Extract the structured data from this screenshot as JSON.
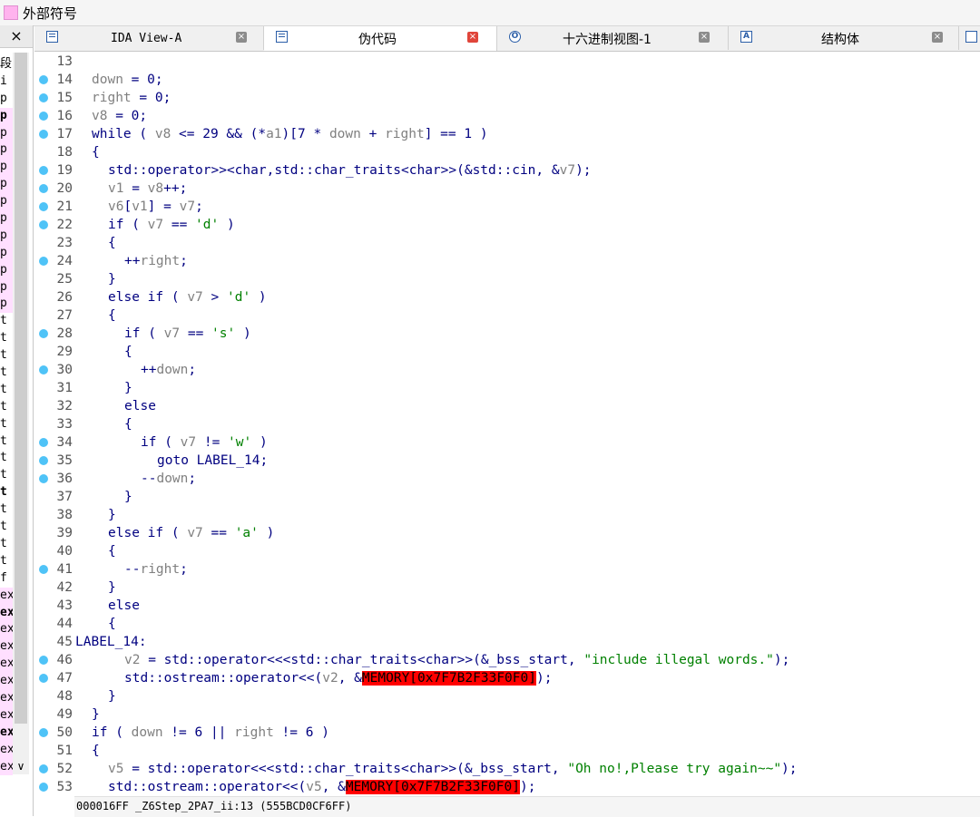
{
  "window": {
    "title": "外部符号"
  },
  "left_panel": {
    "close_label": "×",
    "items": [
      {
        "text": "段",
        "style": ""
      },
      {
        "text": "i",
        "style": ""
      },
      {
        "text": "p",
        "style": ""
      },
      {
        "text": "p",
        "style": "p b"
      },
      {
        "text": "p",
        "style": "p"
      },
      {
        "text": "p",
        "style": "p"
      },
      {
        "text": "p",
        "style": "p"
      },
      {
        "text": "p",
        "style": "p"
      },
      {
        "text": "p",
        "style": "p"
      },
      {
        "text": "p",
        "style": "p"
      },
      {
        "text": "p",
        "style": "p"
      },
      {
        "text": "p",
        "style": "p"
      },
      {
        "text": "p",
        "style": "p"
      },
      {
        "text": "p",
        "style": "p"
      },
      {
        "text": "p",
        "style": "p"
      },
      {
        "text": "t",
        "style": ""
      },
      {
        "text": "t",
        "style": ""
      },
      {
        "text": "t",
        "style": ""
      },
      {
        "text": "t",
        "style": ""
      },
      {
        "text": "t",
        "style": ""
      },
      {
        "text": "t",
        "style": ""
      },
      {
        "text": "t",
        "style": ""
      },
      {
        "text": "t",
        "style": ""
      },
      {
        "text": "t",
        "style": ""
      },
      {
        "text": "t",
        "style": ""
      },
      {
        "text": "t",
        "style": "b"
      },
      {
        "text": "t",
        "style": ""
      },
      {
        "text": "t",
        "style": ""
      },
      {
        "text": "t",
        "style": ""
      },
      {
        "text": "t",
        "style": ""
      },
      {
        "text": "f",
        "style": ""
      },
      {
        "text": "ex",
        "style": "p"
      },
      {
        "text": "ex",
        "style": "p b"
      },
      {
        "text": "ex",
        "style": "p"
      },
      {
        "text": "ex",
        "style": "p"
      },
      {
        "text": "ex",
        "style": "p"
      },
      {
        "text": "ex",
        "style": "p"
      },
      {
        "text": "ex",
        "style": "p"
      },
      {
        "text": "ex",
        "style": "p"
      },
      {
        "text": "ex",
        "style": "p b"
      },
      {
        "text": "ex",
        "style": "p"
      },
      {
        "text": "ex",
        "style": "p"
      }
    ]
  },
  "tabs": [
    {
      "label": "IDA View-A",
      "active": false,
      "icon": "ida-view-icon"
    },
    {
      "label": "伪代码",
      "active": true,
      "icon": "pseudocode-icon"
    },
    {
      "label": "十六进制视图-1",
      "active": false,
      "icon": "hex-view-icon"
    },
    {
      "label": "结构体",
      "active": false,
      "icon": "structures-icon"
    }
  ],
  "code": {
    "lines": [
      {
        "n": "13",
        "dot": false,
        "indent": 0,
        "parts": []
      },
      {
        "n": "14",
        "dot": true,
        "indent": 1,
        "parts": [
          [
            "v",
            "down"
          ],
          [
            "t",
            " = 0;"
          ]
        ]
      },
      {
        "n": "15",
        "dot": true,
        "indent": 1,
        "parts": [
          [
            "v",
            "right"
          ],
          [
            "t",
            " = 0;"
          ]
        ]
      },
      {
        "n": "16",
        "dot": true,
        "indent": 1,
        "parts": [
          [
            "v",
            "v8"
          ],
          [
            "t",
            " = 0;"
          ]
        ]
      },
      {
        "n": "17",
        "dot": true,
        "indent": 1,
        "parts": [
          [
            "t",
            "while ( "
          ],
          [
            "v",
            "v8"
          ],
          [
            "t",
            " <= 29 && (*"
          ],
          [
            "v",
            "a1"
          ],
          [
            "t",
            ")[7 * "
          ],
          [
            "v",
            "down"
          ],
          [
            "t",
            " + "
          ],
          [
            "v",
            "right"
          ],
          [
            "t",
            "] == 1 )"
          ]
        ]
      },
      {
        "n": "18",
        "dot": false,
        "indent": 1,
        "parts": [
          [
            "t",
            "{"
          ]
        ]
      },
      {
        "n": "19",
        "dot": true,
        "indent": 2,
        "parts": [
          [
            "t",
            "std::operator>><char,std::char_traits<char>>(&std::cin, &"
          ],
          [
            "v",
            "v7"
          ],
          [
            "t",
            ");"
          ]
        ]
      },
      {
        "n": "20",
        "dot": true,
        "indent": 2,
        "parts": [
          [
            "v",
            "v1"
          ],
          [
            "t",
            " = "
          ],
          [
            "v",
            "v8"
          ],
          [
            "t",
            "++;"
          ]
        ]
      },
      {
        "n": "21",
        "dot": true,
        "indent": 2,
        "parts": [
          [
            "v",
            "v6"
          ],
          [
            "t",
            "["
          ],
          [
            "v",
            "v1"
          ],
          [
            "t",
            "] = "
          ],
          [
            "v",
            "v7"
          ],
          [
            "t",
            ";"
          ]
        ]
      },
      {
        "n": "22",
        "dot": true,
        "indent": 2,
        "parts": [
          [
            "t",
            "if ( "
          ],
          [
            "v",
            "v7"
          ],
          [
            "t",
            " == "
          ],
          [
            "s",
            "'d'"
          ],
          [
            "t",
            " )"
          ]
        ]
      },
      {
        "n": "23",
        "dot": false,
        "indent": 2,
        "parts": [
          [
            "t",
            "{"
          ]
        ]
      },
      {
        "n": "24",
        "dot": true,
        "indent": 3,
        "parts": [
          [
            "t",
            "++"
          ],
          [
            "v",
            "right"
          ],
          [
            "t",
            ";"
          ]
        ]
      },
      {
        "n": "25",
        "dot": false,
        "indent": 2,
        "parts": [
          [
            "t",
            "}"
          ]
        ]
      },
      {
        "n": "26",
        "dot": false,
        "indent": 2,
        "parts": [
          [
            "t",
            "else if ( "
          ],
          [
            "v",
            "v7"
          ],
          [
            "t",
            " > "
          ],
          [
            "s",
            "'d'"
          ],
          [
            "t",
            " )"
          ]
        ]
      },
      {
        "n": "27",
        "dot": false,
        "indent": 2,
        "parts": [
          [
            "t",
            "{"
          ]
        ]
      },
      {
        "n": "28",
        "dot": true,
        "indent": 3,
        "parts": [
          [
            "t",
            "if ( "
          ],
          [
            "v",
            "v7"
          ],
          [
            "t",
            " == "
          ],
          [
            "s",
            "'s'"
          ],
          [
            "t",
            " )"
          ]
        ]
      },
      {
        "n": "29",
        "dot": false,
        "indent": 3,
        "parts": [
          [
            "t",
            "{"
          ]
        ]
      },
      {
        "n": "30",
        "dot": true,
        "indent": 4,
        "parts": [
          [
            "t",
            "++"
          ],
          [
            "v",
            "down"
          ],
          [
            "t",
            ";"
          ]
        ]
      },
      {
        "n": "31",
        "dot": false,
        "indent": 3,
        "parts": [
          [
            "t",
            "}"
          ]
        ]
      },
      {
        "n": "32",
        "dot": false,
        "indent": 3,
        "parts": [
          [
            "t",
            "else"
          ]
        ]
      },
      {
        "n": "33",
        "dot": false,
        "indent": 3,
        "parts": [
          [
            "t",
            "{"
          ]
        ]
      },
      {
        "n": "34",
        "dot": true,
        "indent": 4,
        "parts": [
          [
            "t",
            "if ( "
          ],
          [
            "v",
            "v7"
          ],
          [
            "t",
            " != "
          ],
          [
            "s",
            "'w'"
          ],
          [
            "t",
            " )"
          ]
        ]
      },
      {
        "n": "35",
        "dot": true,
        "indent": 5,
        "parts": [
          [
            "t",
            "goto LABEL_14;"
          ]
        ]
      },
      {
        "n": "36",
        "dot": true,
        "indent": 4,
        "parts": [
          [
            "t",
            "--"
          ],
          [
            "v",
            "down"
          ],
          [
            "t",
            ";"
          ]
        ]
      },
      {
        "n": "37",
        "dot": false,
        "indent": 3,
        "parts": [
          [
            "t",
            "}"
          ]
        ]
      },
      {
        "n": "38",
        "dot": false,
        "indent": 2,
        "parts": [
          [
            "t",
            "}"
          ]
        ]
      },
      {
        "n": "39",
        "dot": false,
        "indent": 2,
        "parts": [
          [
            "t",
            "else if ( "
          ],
          [
            "v",
            "v7"
          ],
          [
            "t",
            " == "
          ],
          [
            "s",
            "'a'"
          ],
          [
            "t",
            " )"
          ]
        ]
      },
      {
        "n": "40",
        "dot": false,
        "indent": 2,
        "parts": [
          [
            "t",
            "{"
          ]
        ]
      },
      {
        "n": "41",
        "dot": true,
        "indent": 3,
        "parts": [
          [
            "t",
            "--"
          ],
          [
            "v",
            "right"
          ],
          [
            "t",
            ";"
          ]
        ]
      },
      {
        "n": "42",
        "dot": false,
        "indent": 2,
        "parts": [
          [
            "t",
            "}"
          ]
        ]
      },
      {
        "n": "43",
        "dot": false,
        "indent": 2,
        "parts": [
          [
            "t",
            "else"
          ]
        ]
      },
      {
        "n": "44",
        "dot": false,
        "indent": 2,
        "parts": [
          [
            "t",
            "{"
          ]
        ]
      },
      {
        "n": "45",
        "dot": false,
        "indent": 0,
        "label": true,
        "parts": [
          [
            "t",
            "LABEL_14:"
          ]
        ]
      },
      {
        "n": "46",
        "dot": true,
        "indent": 3,
        "parts": [
          [
            "v",
            "v2"
          ],
          [
            "t",
            " = std::operator<<<std::char_traits<char>>(&_bss_start, "
          ],
          [
            "s",
            "\"include illegal words.\""
          ],
          [
            "t",
            ");"
          ]
        ]
      },
      {
        "n": "47",
        "dot": true,
        "indent": 3,
        "parts": [
          [
            "t",
            "std::ostream::operator<<("
          ],
          [
            "v",
            "v2"
          ],
          [
            "t",
            ", &"
          ],
          [
            "m",
            "MEMORY[0x7F7B2F33F0F0]"
          ],
          [
            "t",
            ");"
          ]
        ]
      },
      {
        "n": "48",
        "dot": false,
        "indent": 2,
        "parts": [
          [
            "t",
            "}"
          ]
        ]
      },
      {
        "n": "49",
        "dot": false,
        "indent": 1,
        "parts": [
          [
            "t",
            "}"
          ]
        ]
      },
      {
        "n": "50",
        "dot": true,
        "indent": 1,
        "parts": [
          [
            "t",
            "if ( "
          ],
          [
            "v",
            "down"
          ],
          [
            "t",
            " != 6 || "
          ],
          [
            "v",
            "right"
          ],
          [
            "t",
            " != 6 )"
          ]
        ]
      },
      {
        "n": "51",
        "dot": false,
        "indent": 1,
        "parts": [
          [
            "t",
            "{"
          ]
        ]
      },
      {
        "n": "52",
        "dot": true,
        "indent": 2,
        "parts": [
          [
            "v",
            "v5"
          ],
          [
            "t",
            " = std::operator<<<std::char_traits<char>>(&_bss_start, "
          ],
          [
            "s",
            "\"Oh no!,Please try again~~\""
          ],
          [
            "t",
            ");"
          ]
        ]
      },
      {
        "n": "53",
        "dot": true,
        "indent": 2,
        "parts": [
          [
            "t",
            "std::ostream::operator<<("
          ],
          [
            "v",
            "v5"
          ],
          [
            "t",
            ", &"
          ],
          [
            "m",
            "MEMORY[0x7F7B2F33F0F0]"
          ],
          [
            "t",
            ");"
          ]
        ]
      }
    ]
  },
  "status": {
    "text": "000016FF _Z6Step_2PA7_ii:13 (555BCD0CF6FF)"
  },
  "colors": {
    "keyword": "#000080",
    "variable": "#808080",
    "string": "#008000",
    "memory_bg": "#ff0000",
    "breakpoint_dot": "#4fc3f7"
  }
}
